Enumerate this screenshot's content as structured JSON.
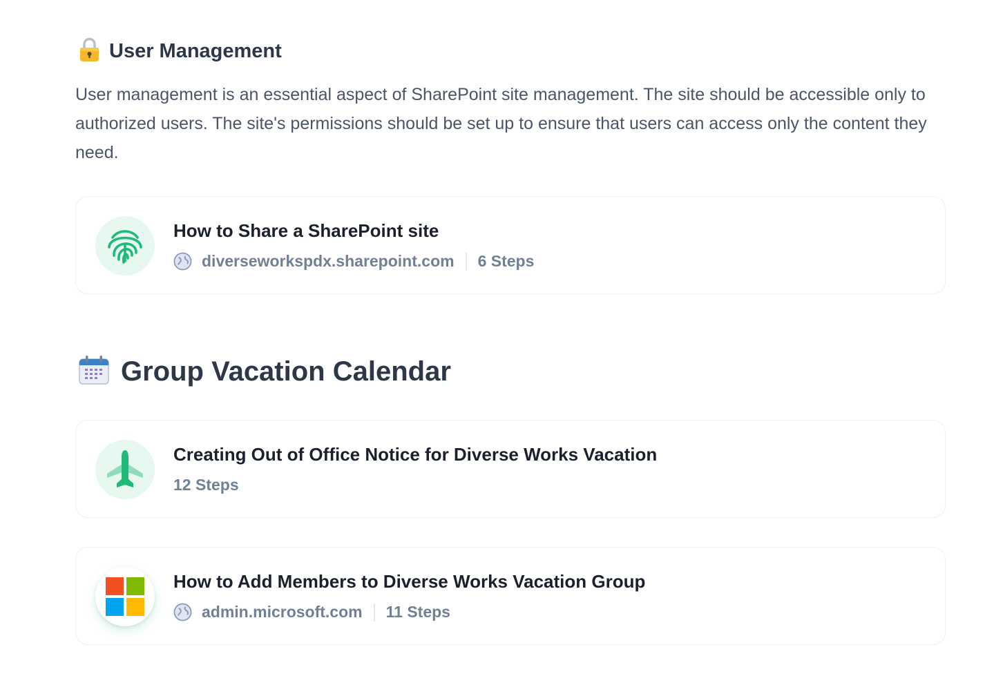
{
  "user_management": {
    "icon": "lock-icon",
    "title": "User Management",
    "description": "User management is an essential aspect of SharePoint site management. The site should be accessible only to authorized users. The site's permissions should be set up to ensure that users can access only the content they need."
  },
  "group_vacation_calendar": {
    "icon": "calendar-icon",
    "title": "Group Vacation Calendar"
  },
  "cards": [
    {
      "icon": "fingerprint-icon",
      "title": "How to Share a SharePoint site",
      "domain": "diverseworkspdx.sharepoint.com",
      "steps": "6 Steps"
    },
    {
      "icon": "airplane-icon",
      "title": "Creating Out of Office Notice for Diverse Works Vacation",
      "steps": "12 Steps"
    },
    {
      "icon": "microsoft-logo-icon",
      "title": "How to Add Members to Diverse Works Vacation Group",
      "domain": "admin.microsoft.com",
      "steps": "11 Steps"
    }
  ],
  "colors": {
    "heading": "#2d3748",
    "body_text": "#4a5568",
    "meta_text": "#718096",
    "icon_green": "#1fb978",
    "icon_bg": "#e6f8f0"
  }
}
